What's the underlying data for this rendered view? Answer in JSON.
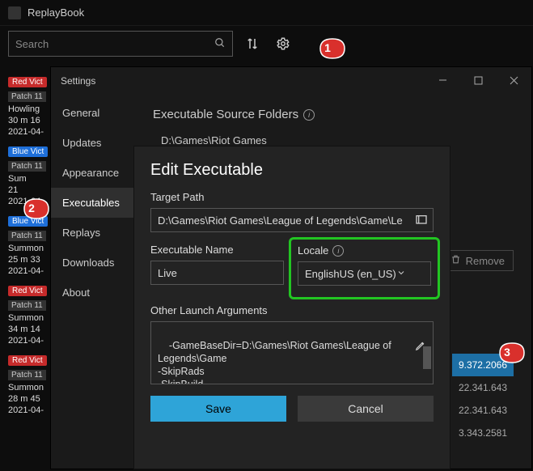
{
  "app": {
    "title": "ReplayBook"
  },
  "search": {
    "placeholder": "Search"
  },
  "replays": [
    {
      "badge": "Red Vict",
      "badge_class": "red",
      "patch": "Patch 11",
      "line1": "Howling",
      "line2": "30 m 16",
      "line3": "2021-04-"
    },
    {
      "badge": "Blue Vict",
      "badge_class": "blue",
      "patch": "Patch 11",
      "line1": "Sum",
      "line2": "21",
      "line3": "2021-04-"
    },
    {
      "badge": "Blue Vict",
      "badge_class": "blue",
      "patch": "Patch 11",
      "line1": "Summon",
      "line2": "25 m 33",
      "line3": "2021-04-"
    },
    {
      "badge": "Red Vict",
      "badge_class": "red",
      "patch": "Patch 11",
      "line1": "Summon",
      "line2": "34 m 14",
      "line3": "2021-04-"
    },
    {
      "badge": "Red Vict",
      "badge_class": "red",
      "patch": "Patch 11",
      "line1": "Summon",
      "line2": "28 m 45",
      "line3": "2021-04-"
    }
  ],
  "settings": {
    "title": "Settings",
    "nav": [
      "General",
      "Updates",
      "Appearance",
      "Executables",
      "Replays",
      "Downloads",
      "About"
    ],
    "active_index": 3,
    "section_header": "Executable Source Folders",
    "folder_path": "D:\\Games\\Riot Games",
    "remove_label": "Remove",
    "versions": [
      "9.372.2066",
      "22.341.643",
      "22.341.643",
      "3.343.2581"
    ],
    "highlight_index": 0
  },
  "dialog": {
    "title": "Edit Executable",
    "target_path_label": "Target Path",
    "target_path_value": "D:\\Games\\Riot Games\\League of Legends\\Game\\Le",
    "exec_name_label": "Executable Name",
    "exec_name_value": "Live",
    "locale_label": "Locale",
    "locale_value": "EnglishUS (en_US)",
    "other_args_label": "Other Launch Arguments",
    "other_args_value": "-GameBaseDir=D:\\Games\\Riot Games\\League of Legends\\Game\n-SkipRads\n-SkipBuild",
    "save_label": "Save",
    "cancel_label": "Cancel"
  },
  "annotations": {
    "a1": "1",
    "a2": "2",
    "a3": "3"
  }
}
